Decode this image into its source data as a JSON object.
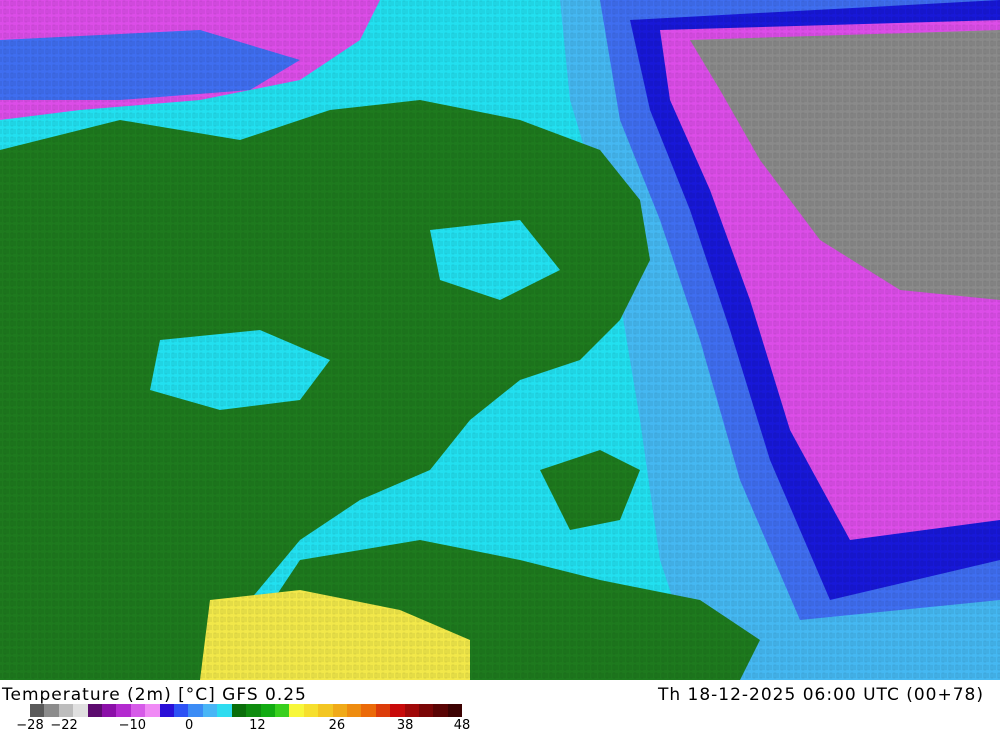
{
  "map": {
    "land_color": "#1e7a1e",
    "colors": {
      "cyan": "#22e0f0",
      "light_blue": "#45b8f2",
      "blue": "#3f6ef0",
      "deep_blue": "#1818d8",
      "magenta": "#dc4de8",
      "gray": "#8a8a8a",
      "yellow": "#f2e84a",
      "green": "#0e6e0e"
    }
  },
  "footer": {
    "title": "Temperature (2m) [°C] GFS 0.25",
    "valid_time": "Th 18-12-2025 06:00 UTC (00+78)",
    "scale_colors": [
      "#5a5a5a",
      "#8c8c8c",
      "#bdbdbd",
      "#e0e0e0",
      "#5c0b6e",
      "#8b0fa8",
      "#b32bcf",
      "#d65be8",
      "#f08af5",
      "#2a10d8",
      "#2d52f5",
      "#3c8cf5",
      "#49b6f6",
      "#2fdcf0",
      "#0a6e0a",
      "#0f8c0f",
      "#12ab12",
      "#38cf1e",
      "#f7f73a",
      "#f6df2e",
      "#f3c622",
      "#f0aa18",
      "#ee8c10",
      "#eb6a08",
      "#dc3c0a",
      "#c80a0a",
      "#a00808",
      "#7a0606",
      "#5a0404",
      "#3c0202"
    ],
    "scale_labels": [
      {
        "text": "−28",
        "value": -28
      },
      {
        "text": "−22",
        "value": -22
      },
      {
        "text": "−10",
        "value": -10
      },
      {
        "text": "0",
        "value": 0
      },
      {
        "text": "12",
        "value": 12
      },
      {
        "text": "26",
        "value": 26
      },
      {
        "text": "38",
        "value": 38
      },
      {
        "text": "48",
        "value": 48
      }
    ]
  }
}
